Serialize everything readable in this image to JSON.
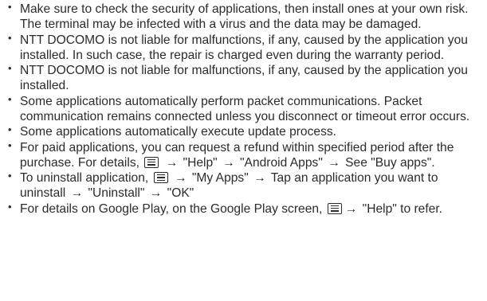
{
  "items": [
    {
      "text": "Make sure to check the security of applications, then install ones at your own risk. The terminal may be infected with a virus and the data may be damaged."
    },
    {
      "text": "NTT DOCOMO is not liable for malfunctions, if any, caused by the application you installed. In such case, the repair is charged even during the warranty period."
    },
    {
      "text": "NTT DOCOMO is not liable for malfunctions, if any, caused by the application you installed."
    },
    {
      "text": "Some applications automatically perform packet communications. Packet communication remains connected unless you disconnect or timeout error occurs."
    },
    {
      "text": "Some applications automatically execute update process."
    },
    {
      "lead": "For paid applications, you can request a refund within specified period after the purchase. For details,",
      "arrow": "→",
      "step1": "\"Help\"",
      "step2": "\"Android Apps\"",
      "tail": "See \"Buy apps\"."
    },
    {
      "lead": "To uninstall application,",
      "arrow": "→",
      "step1": "\"My Apps\"",
      "step2": "Tap an application you want to uninstall",
      "step3": "\"Uninstall\"",
      "step4": "\"OK\""
    },
    {
      "lead": "For details on Google Play, on the Google Play screen,",
      "arrow": "→",
      "tail": "\"Help\" to refer."
    }
  ],
  "bullet": "•",
  "icons": {
    "menu": "menu-key-icon"
  }
}
